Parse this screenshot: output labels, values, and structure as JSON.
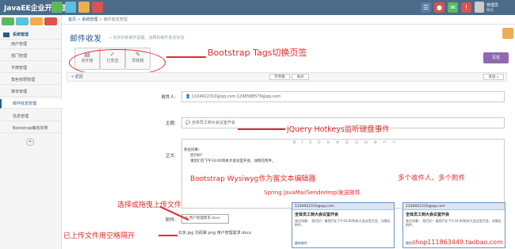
{
  "nav": {
    "logo": "JavaEE企业开发框架",
    "user_name": "管理员",
    "user_sub": "帐号"
  },
  "side": {
    "items": [
      "系统管理",
      "用户管理",
      "部门管理",
      "字典管理",
      "角色权限管理",
      "菜单管理",
      "邮件收发管理",
      "信息管理",
      "Bootstrap静态实例"
    ]
  },
  "breadcrumb": {
    "home": "首页",
    "mid": "系统管理",
    "current": "邮件收发管理"
  },
  "page": {
    "title": "邮件收发",
    "subtitle": "» 实时的新邮件提醒，消释的邮件收发体验",
    "write_btn": "写信"
  },
  "tabs": [
    "收件箱",
    "已发送",
    "草稿箱"
  ],
  "toolbar": {
    "back": "« 返回",
    "save": "存草稿",
    "close": "关闭",
    "send": "发送 »"
  },
  "form": {
    "to_label": "收件人:",
    "to_value": "1104922310@qq.com,1298588579@qq.com",
    "subject_label": "主题:",
    "subject_value": "全体员工到大会议室开会",
    "body_label": "正文:",
    "body_text": [
      "各位同事：",
      "您们好！",
      "请您们在下午16:00到本大会议室开会，详情见附件。"
    ],
    "attach_label": "附件:",
    "attach_file": "用户管理需求.docx",
    "attach_list": "北京.jpg 刘而掌.png 用户管理需求.docx"
  },
  "annotations": {
    "tabs": "Bootstrap Tags切换页签",
    "hotkeys": "jQuery Hotkeys监听键盘事件",
    "wysiwyg": "Bootstrap Wysiwyg作为富文本编辑器",
    "mail": "Spring JavaMailSenderImpl发送邮件",
    "multi": "多个收件人、多个附件",
    "upload": "选择或拖曳上传文件",
    "spaces": "已上传文件用空格隔开"
  },
  "popup": {
    "title": "全体员工到大会议室开会",
    "from": "1104922310@qq.com",
    "body": "各位同事：  您们好！请您们在下午16:00到本大会议室开会，详情见附件。",
    "delete": "删除邮件"
  },
  "watermark": "shop111863449.taobao.com",
  "colors": {
    "nav": "#4a6b8a",
    "accent": "#e52b2b",
    "purple": "#8e6bb0"
  }
}
